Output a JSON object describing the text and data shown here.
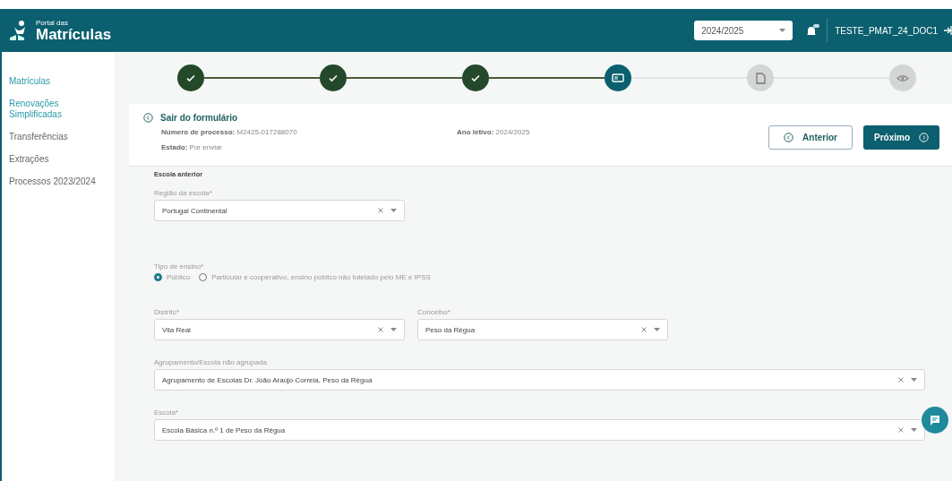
{
  "header": {
    "logo_small": "Portal das",
    "logo_big": "Matrículas",
    "year_select": "2024/2025",
    "user": "TESTE_PMAT_24_DOC1"
  },
  "sidebar": {
    "items": [
      {
        "label": "Matrículas",
        "selected": true
      },
      {
        "label": "Renovações Simplificadas",
        "selected": true
      },
      {
        "label": "Transferências",
        "selected": false
      },
      {
        "label": "Extrações",
        "selected": false
      },
      {
        "label": "Processos 2023/2024",
        "selected": false
      }
    ]
  },
  "stepper": [
    {
      "kind": "done"
    },
    {
      "kind": "done"
    },
    {
      "kind": "done"
    },
    {
      "kind": "current"
    },
    {
      "kind": "pending"
    },
    {
      "kind": "pending"
    }
  ],
  "form_header": {
    "exit_link": "Sair do formulário",
    "process": "**Número de processo:** M2425-017288070",
    "state": "**Estado:** Por enviar",
    "school_year": "**Ano letivo:** 2024/2025",
    "prev_button": "Anterior",
    "next_button": "Próximo"
  },
  "section_title": "Escola anterior",
  "region": {
    "label": "Região da escola*",
    "value": "Portugal Continental"
  },
  "teaching_type": {
    "label": "Tipo de ensino*",
    "options": [
      {
        "label": "Público",
        "selected": true
      },
      {
        "label": "Particular e cooperativo, ensino público não tutelado pelo ME e IPSS",
        "selected": false
      }
    ]
  },
  "district": {
    "label": "Distrito*",
    "value": "Vila Real"
  },
  "council": {
    "label": "Concelho*",
    "value": "Peso da Régua"
  },
  "cluster": {
    "label": "Agrupamento/Escola não agrupada",
    "value": "Agrupamento de Escolas Dr. João Araújo Correia, Peso da Régua"
  },
  "school": {
    "label": "Escola*",
    "value": "Escola Básica n.º 1 de Peso da Régua"
  }
}
